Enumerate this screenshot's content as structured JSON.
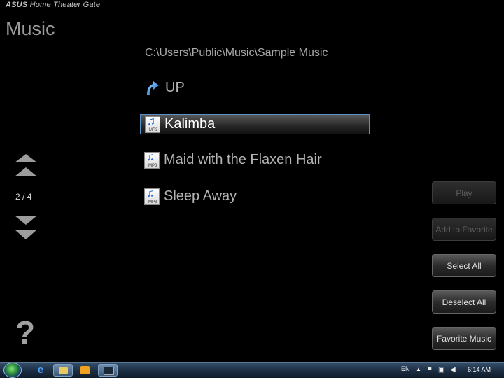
{
  "app": {
    "brand_logo": "ASUS",
    "brand_name": "Home Theater Gate",
    "section_title": "Music"
  },
  "browser": {
    "path": "C:\\Users\\Public\\Music\\Sample Music",
    "items": [
      {
        "label": "UP",
        "icon": "up-arrow-icon"
      },
      {
        "label": "Kalimba",
        "icon": "mp3-file-icon",
        "selected": true
      },
      {
        "label": "Maid with the Flaxen Hair",
        "icon": "mp3-file-icon"
      },
      {
        "label": "Sleep Away",
        "icon": "mp3-file-icon"
      }
    ],
    "mp3_tag": "MP3"
  },
  "pager": {
    "current": "2",
    "separator": "/",
    "total": "4"
  },
  "help": {
    "glyph": "?"
  },
  "actions": {
    "play": "Play",
    "add_favorite": "Add to Favorite",
    "select_all": "Select All",
    "deselect_all": "Deselect All",
    "favorite_music": "Favorite Music"
  },
  "taskbar": {
    "language": "EN",
    "tray_arrow": "▲",
    "time": "6:14 AM",
    "ie_glyph": "e"
  },
  "colors": {
    "selection_border": "#5b8fc8",
    "background": "#000000",
    "taskbar": "#1d2f45"
  }
}
